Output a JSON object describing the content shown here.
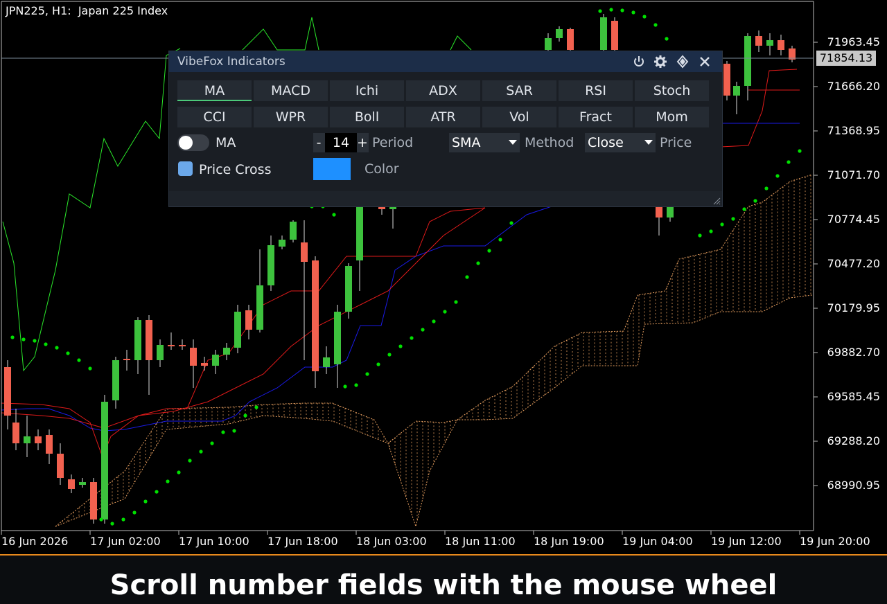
{
  "header": {
    "symbol": "JPN225, H1:  Japan 225 Index"
  },
  "current_price": "71854.13",
  "price_axis": [
    "71963.45",
    "71666.20",
    "71368.95",
    "71071.70",
    "70774.45",
    "70477.20",
    "70179.95",
    "69882.70",
    "69585.45",
    "69288.20",
    "68990.95"
  ],
  "time_axis": [
    "16 Jun 2026",
    "17 Jun 02:00",
    "17 Jun 10:00",
    "17 Jun 18:00",
    "18 Jun 03:00",
    "18 Jun 11:00",
    "18 Jun 19:00",
    "19 Jun 04:00",
    "19 Jun 12:00",
    "19 Jun 20:00"
  ],
  "colors": {
    "bull": "#3dc23d",
    "bear": "#f2614f",
    "swatch": "#1e90ff",
    "cloud": "#e8a060",
    "sar": "#00e000",
    "ma_red": "#e01a1a",
    "ma_blue": "#1a1ae8",
    "chikou": "#2ae82a",
    "accent": "#e8891c"
  },
  "panel": {
    "title": "VibeFox Indicators",
    "icons": [
      "power-icon",
      "gear-icon",
      "move-icon",
      "close-icon"
    ],
    "tabs_row1": [
      "MA",
      "MACD",
      "Ichi",
      "ADX",
      "SAR",
      "RSI",
      "Stoch"
    ],
    "tabs_row2": [
      "CCI",
      "WPR",
      "Boll",
      "ATR",
      "Vol",
      "Fract",
      "Mom"
    ],
    "active_tab": "MA",
    "toggle_label": "MA",
    "toggle_on": false,
    "period": {
      "minus": "-",
      "value": "14",
      "plus": "+",
      "label": "Period"
    },
    "method": {
      "value": "SMA",
      "label": "Method"
    },
    "price": {
      "value": "Close",
      "label": "Price"
    },
    "price_cross_label": "Price Cross",
    "color_label": "Color"
  },
  "caption": "Scroll number fields with the mouse wheel"
}
